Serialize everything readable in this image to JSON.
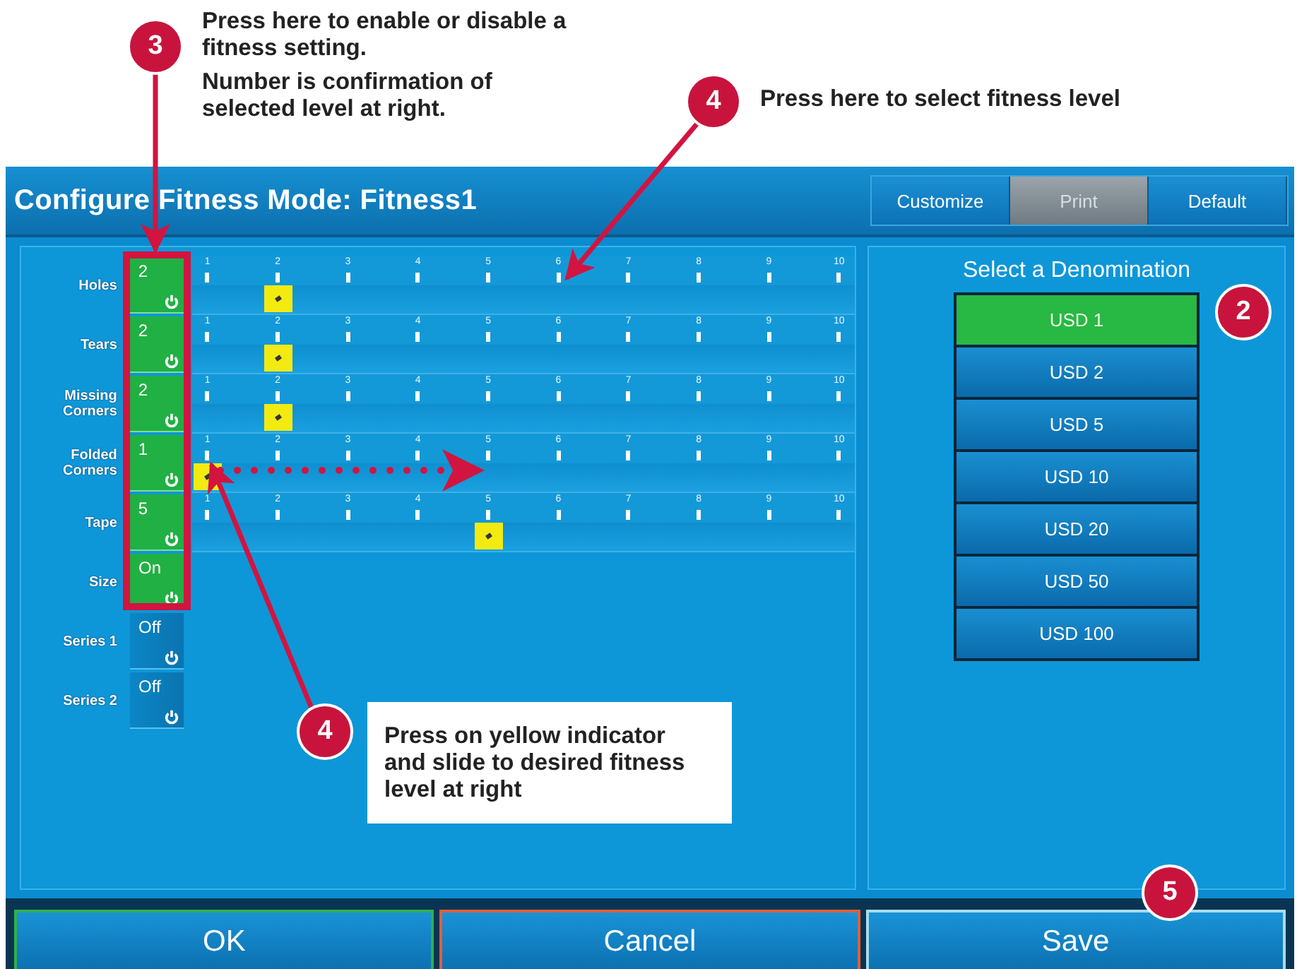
{
  "window": {
    "title": "Configure Fitness Mode: Fitness1"
  },
  "tabs": [
    {
      "label": "Customize",
      "disabled": false
    },
    {
      "label": "Print",
      "disabled": true
    },
    {
      "label": "Default",
      "disabled": false
    }
  ],
  "settings": [
    {
      "label": "Holes",
      "value": "2",
      "on": true,
      "ticks": [
        {
          "label": "1",
          "selected": false
        },
        {
          "label": "2",
          "selected": true
        },
        {
          "label": "3",
          "selected": false
        },
        {
          "label": "4",
          "selected": false
        },
        {
          "label": "5",
          "selected": false
        },
        {
          "label": "6",
          "selected": false
        },
        {
          "label": "7",
          "selected": false
        },
        {
          "label": "8",
          "selected": false
        },
        {
          "label": "9",
          "selected": false
        },
        {
          "label": "10",
          "selected": false
        }
      ]
    },
    {
      "label": "Tears",
      "value": "2",
      "on": true,
      "ticks": [
        {
          "label": "1",
          "selected": false
        },
        {
          "label": "2",
          "selected": true
        },
        {
          "label": "3",
          "selected": false
        },
        {
          "label": "4",
          "selected": false
        },
        {
          "label": "5",
          "selected": false
        },
        {
          "label": "6",
          "selected": false
        },
        {
          "label": "7",
          "selected": false
        },
        {
          "label": "8",
          "selected": false
        },
        {
          "label": "9",
          "selected": false
        },
        {
          "label": "10",
          "selected": false
        }
      ]
    },
    {
      "label": "Missing Corners",
      "value": "2",
      "on": true,
      "ticks": [
        {
          "label": "1",
          "selected": false
        },
        {
          "label": "2",
          "selected": true
        },
        {
          "label": "3",
          "selected": false
        },
        {
          "label": "4",
          "selected": false
        },
        {
          "label": "5",
          "selected": false
        },
        {
          "label": "6",
          "selected": false
        },
        {
          "label": "7",
          "selected": false
        },
        {
          "label": "8",
          "selected": false
        },
        {
          "label": "9",
          "selected": false
        },
        {
          "label": "10",
          "selected": false
        }
      ]
    },
    {
      "label": "Folded Corners",
      "value": "1",
      "on": true,
      "ticks": [
        {
          "label": "1",
          "selected": true
        },
        {
          "label": "2",
          "selected": false
        },
        {
          "label": "3",
          "selected": false
        },
        {
          "label": "4",
          "selected": false
        },
        {
          "label": "5",
          "selected": false
        },
        {
          "label": "6",
          "selected": false
        },
        {
          "label": "7",
          "selected": false
        },
        {
          "label": "8",
          "selected": false
        },
        {
          "label": "9",
          "selected": false
        },
        {
          "label": "10",
          "selected": false
        }
      ]
    },
    {
      "label": "Tape",
      "value": "5",
      "on": true,
      "ticks": [
        {
          "label": "1",
          "selected": false
        },
        {
          "label": "2",
          "selected": false
        },
        {
          "label": "3",
          "selected": false
        },
        {
          "label": "4",
          "selected": false
        },
        {
          "label": "5",
          "selected": true
        },
        {
          "label": "6",
          "selected": false
        },
        {
          "label": "7",
          "selected": false
        },
        {
          "label": "8",
          "selected": false
        },
        {
          "label": "9",
          "selected": false
        },
        {
          "label": "10",
          "selected": false
        }
      ]
    },
    {
      "label": "Size",
      "value": "On",
      "on": true
    },
    {
      "label": "Series 1",
      "value": "Off",
      "on": false
    },
    {
      "label": "Series 2",
      "value": "Off",
      "on": false
    }
  ],
  "denomination": {
    "title": "Select a Denomination",
    "items": [
      {
        "label": "USD 1",
        "selected": true
      },
      {
        "label": "USD 2",
        "selected": false
      },
      {
        "label": "USD 5",
        "selected": false
      },
      {
        "label": "USD 10",
        "selected": false
      },
      {
        "label": "USD 20",
        "selected": false
      },
      {
        "label": "USD 50",
        "selected": false
      },
      {
        "label": "USD 100",
        "selected": false
      }
    ]
  },
  "buttons": [
    {
      "label": "OK",
      "color": "#2fb04c"
    },
    {
      "label": "Cancel",
      "color": "#e0603a"
    },
    {
      "label": "Save",
      "color": "#a8dcef"
    }
  ],
  "callouts": [
    {
      "number": "3",
      "notes": [
        "Press here to enable or disable a fitness setting.",
        "Number is confirmation of selected level at right."
      ]
    },
    {
      "number": "4",
      "notes": [
        "Press here to select fitness level"
      ]
    },
    {
      "number": "2"
    },
    {
      "number": "4",
      "notes": [
        "Press on yellow indicator and slide to desired fitness level at right"
      ]
    },
    {
      "number": "5"
    }
  ]
}
